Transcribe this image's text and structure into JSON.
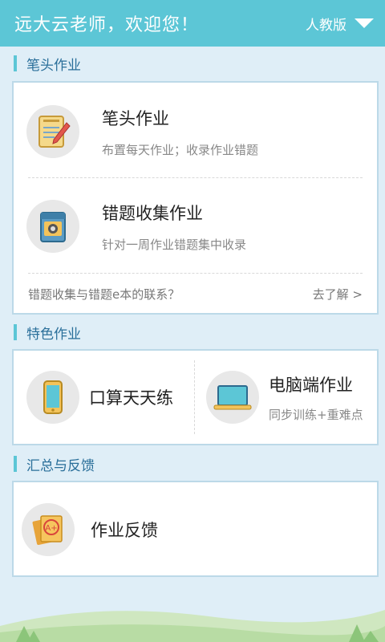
{
  "header": {
    "title": "远大云老师，欢迎您！",
    "edition": "人教版"
  },
  "sections": {
    "pen_homework": "笔头作业",
    "special_homework": "特色作业",
    "summary_feedback": "汇总与反馈"
  },
  "pen_card": {
    "item1_title": "笔头作业",
    "item1_sub": "布置每天作业；收录作业错题",
    "item2_title": "错题收集作业",
    "item2_sub": "针对一周作业错题集中收录",
    "footer_text": "错题收集与错题e本的联系？",
    "footer_link": "去了解 >"
  },
  "special_card": {
    "left_title": "口算天天练",
    "right_title": "电脑端作业",
    "right_sub": "同步训练+重难点"
  },
  "feedback_card": {
    "title": "作业反馈",
    "badge": "A+"
  },
  "colors": {
    "header": "#5cc6d6",
    "background": "#dfeef7",
    "card_border": "#bcd9e8"
  }
}
